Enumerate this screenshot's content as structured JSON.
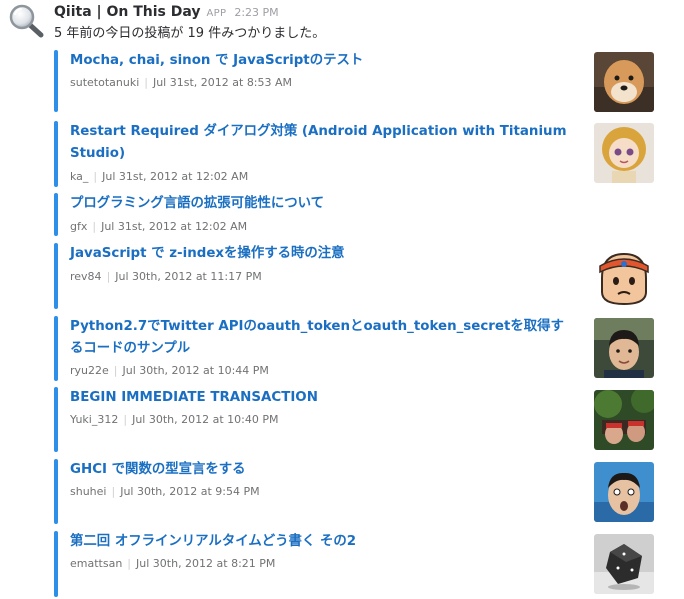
{
  "message": {
    "sender": "Qiita | On This Day",
    "badge": "APP",
    "time": "2:23 PM",
    "intro": "5 年前の今日の投稿が 19 件みつかりました。"
  },
  "attachments": [
    {
      "title": "Mocha, chai, sinon で JavaScriptのテスト",
      "author": "sutetotanuki",
      "date": "Jul 31st, 2012 at 8:53 AM",
      "thumbnail": "dog-photo"
    },
    {
      "title": "Restart Required ダイアログ対策 (Android Application with Titanium Studio)",
      "author": "ka_",
      "date": "Jul 31st, 2012 at 12:02 AM",
      "thumbnail": "doll-photo"
    },
    {
      "title": "プログラミング言語の拡張可能性について",
      "author": "gfx",
      "date": "Jul 31st, 2012 at 12:02 AM",
      "thumbnail": ""
    },
    {
      "title": "JavaScript で z-indexを操作する時の注意",
      "author": "rev84",
      "date": "Jul 30th, 2012 at 11:17 PM",
      "thumbnail": "cartoon-face"
    },
    {
      "title": "Python2.7でTwitter APIのoauth_tokenとoauth_token_secretを取得するコードのサンプル",
      "author": "ryu22e",
      "date": "Jul 30th, 2012 at 10:44 PM",
      "thumbnail": "man-photo"
    },
    {
      "title": "BEGIN IMMEDIATE TRANSACTION",
      "author": "Yuki_312",
      "date": "Jul 30th, 2012 at 10:40 PM",
      "thumbnail": "outdoor-photo"
    },
    {
      "title": "GHCI で関数の型宣言をする",
      "author": "shuhei",
      "date": "Jul 30th, 2012 at 9:54 PM",
      "thumbnail": "surprised-face-photo"
    },
    {
      "title": "第二回 オフラインリアルタイムどう書く その2",
      "author": "emattsan",
      "date": "Jul 30th, 2012 at 8:21 PM",
      "thumbnail": "dice-photo"
    }
  ],
  "colors": {
    "link": "#1b6fc2",
    "accent_bar": "#2d8fe8",
    "meta": "#717274"
  }
}
